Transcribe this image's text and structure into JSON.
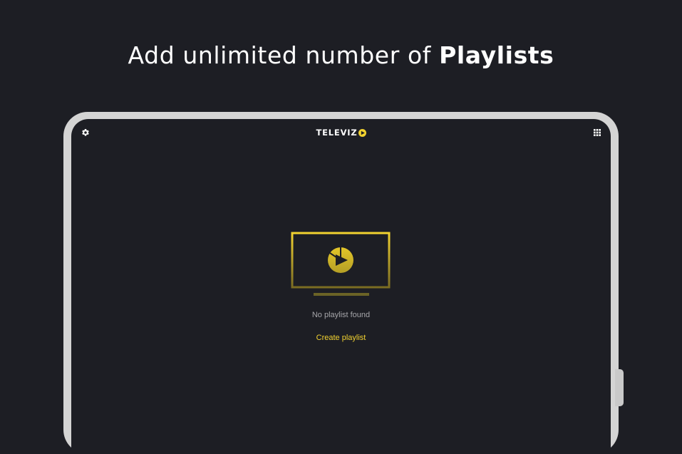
{
  "promo": {
    "headline_regular": "Add unlimited number of ",
    "headline_bold": "Playlists"
  },
  "app": {
    "logo_text": "TELEVIZ",
    "logo_mark_icon": "play-circle-icon",
    "settings_icon": "gear-icon",
    "menu_icon": "grid-icon"
  },
  "empty_state": {
    "illustration_icon": "tv-play-icon",
    "message": "No playlist found",
    "action_label": "Create playlist"
  },
  "colors": {
    "background": "#1d1e24",
    "accent": "#f2d230",
    "device_frame": "#d4d4d4",
    "muted_text": "#a6a6aa"
  }
}
